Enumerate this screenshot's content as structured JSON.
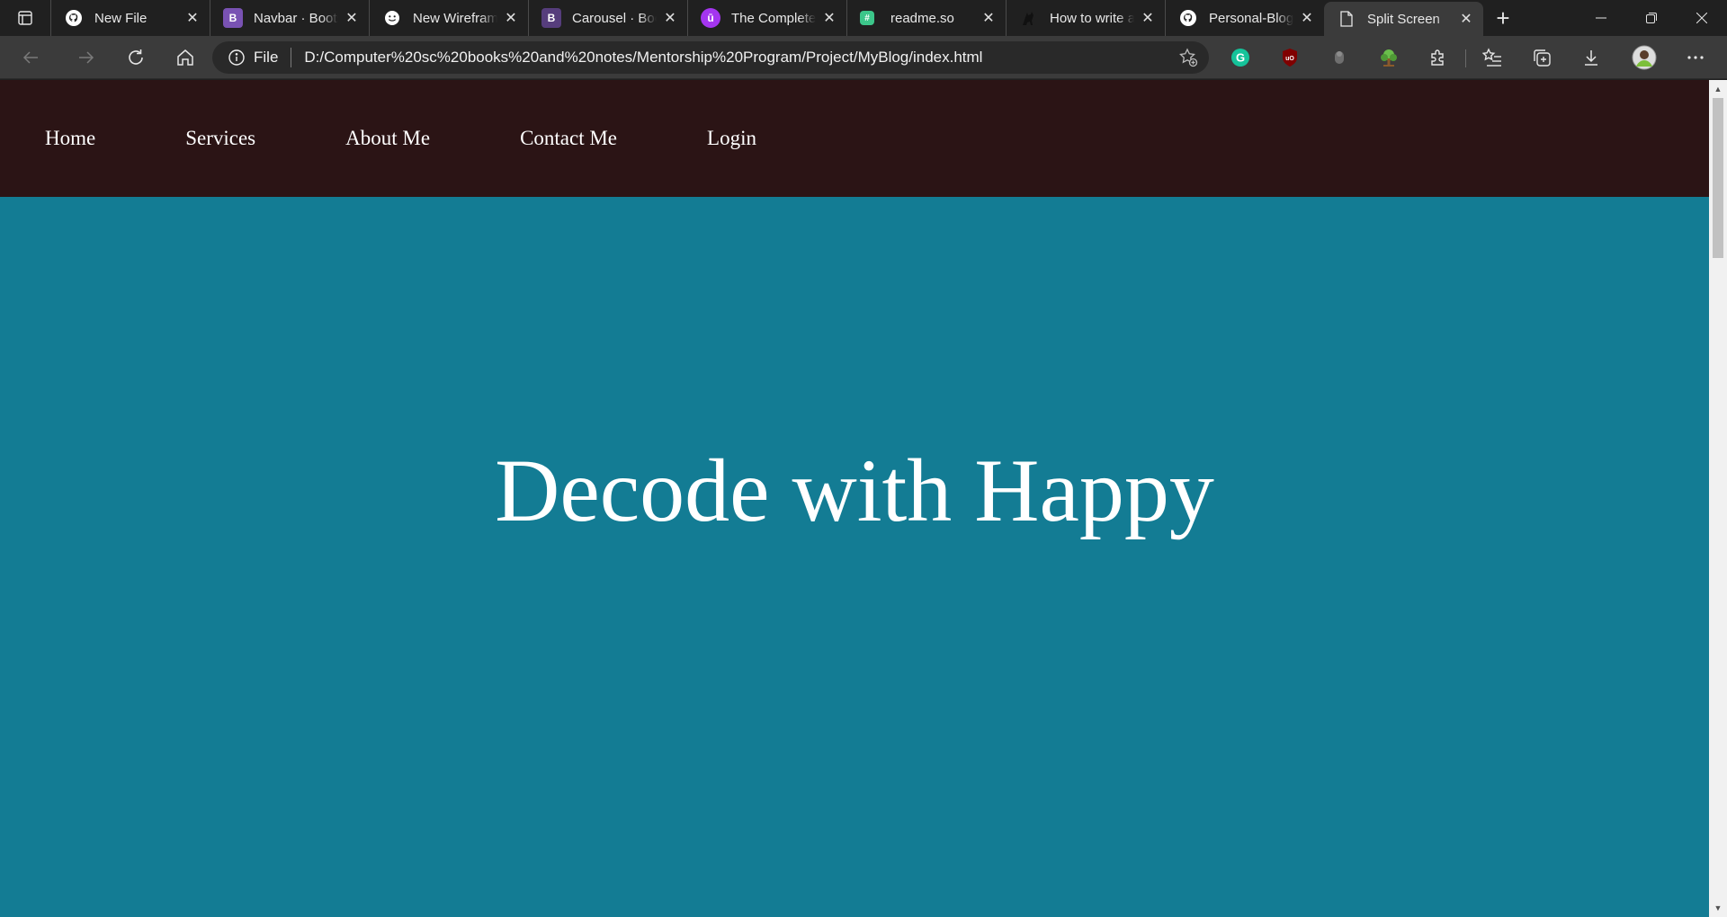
{
  "browser": {
    "tabs": [
      {
        "title": "New File",
        "icon": "github-icon",
        "active": false
      },
      {
        "title": "Navbar · Bootstrap",
        "icon": "bootstrap-icon",
        "active": false
      },
      {
        "title": "New Wireframe",
        "icon": "smiley-icon",
        "active": false
      },
      {
        "title": "Carousel · Bootstrap",
        "icon": "bootstrap-icon",
        "active": false
      },
      {
        "title": "The Complete",
        "icon": "udemy-icon",
        "active": false
      },
      {
        "title": "readme.so",
        "icon": "readme-icon",
        "active": false
      },
      {
        "title": "How to write a",
        "icon": "cat-icon",
        "active": false
      },
      {
        "title": "Personal-Blog",
        "icon": "github-icon",
        "active": false
      },
      {
        "title": "Split Screen",
        "icon": "file-icon",
        "active": true
      }
    ],
    "address": {
      "scheme_label": "File",
      "url": "D:/Computer%20sc%20books%20and%20notes/Mentorship%20Program/Project/MyBlog/index.html"
    },
    "colors": {
      "tabstrip_bg": "#202020",
      "toolbar_bg": "#3b3b3b",
      "omnibox_bg": "#292929"
    }
  },
  "site": {
    "nav": [
      "Home",
      "Services",
      "About Me",
      "Contact Me",
      "Login"
    ],
    "hero_title": "Decode with Happy",
    "colors": {
      "nav_bg": "#2b1415",
      "hero_bg": "#137c94",
      "text": "#ffffff"
    }
  }
}
